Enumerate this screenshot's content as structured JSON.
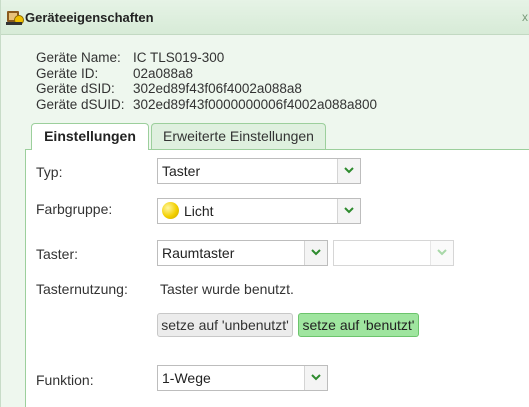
{
  "window": {
    "title": "Geräteeigenschaften",
    "close": "x",
    "icon": "gear-device-icon"
  },
  "device_info": [
    {
      "key": "Geräte Name:",
      "value": "IC TLS019-300"
    },
    {
      "key": "Geräte ID:",
      "value": "02a088a8"
    },
    {
      "key": "Geräte dSID:",
      "value": "302ed89f43f06f4002a088a8"
    },
    {
      "key": "Geräte dSUID:",
      "value": "302ed89f43f0000000006f4002a088a800"
    }
  ],
  "tabs": [
    {
      "label": "Einstellungen",
      "active": true
    },
    {
      "label": "Erweiterte Einstellungen",
      "active": false
    }
  ],
  "settings": {
    "typ": {
      "label": "Typ:",
      "value": "Taster"
    },
    "farbgruppe": {
      "label": "Farbgruppe:",
      "value": "Licht",
      "color": "#f3d000"
    },
    "taster": {
      "label": "Taster:",
      "value": "Raumtaster",
      "second_value": ""
    },
    "tasternutzung": {
      "label": "Tasternutzung:",
      "status": "Taster wurde benutzt.",
      "btn_unused": "setze auf 'unbenutzt'",
      "btn_used": "setze auf 'benutzt'"
    },
    "funktion": {
      "label": "Funktion:",
      "value": "1-Wege"
    }
  },
  "colors": {
    "accent_green": "#9fe59f",
    "border_green": "#9ccf9c",
    "chevron": "#2e8b2e"
  }
}
